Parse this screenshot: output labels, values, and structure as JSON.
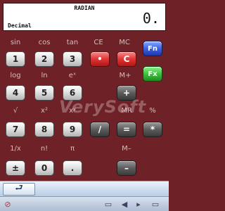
{
  "display": {
    "mode": "RADIAN",
    "value": "0.",
    "base": "Decimal"
  },
  "labels": {
    "sin": "sin",
    "cos": "cos",
    "tan": "tan",
    "ce": "CE",
    "mc": "MC",
    "log": "log",
    "ln": "ln",
    "exp": "eˣ",
    "mplus": "M+",
    "sqrt": "√",
    "square": "x²",
    "pow": "xʸ",
    "mr": "MR",
    "percent": "%",
    "recip": "1/x",
    "factorial": "n!",
    "pi": "π",
    "mminus": "M–"
  },
  "keys": {
    "k1": "1",
    "k2": "2",
    "k3": "3",
    "ce": "•",
    "mc": "C",
    "fn": "Fn",
    "fx": "Fx",
    "k4": "4",
    "k5": "5",
    "k6": "6",
    "plus": "+",
    "k7": "7",
    "k8": "8",
    "k9": "9",
    "divide": "/",
    "equals": "=",
    "multiply": "*",
    "sign": "±",
    "k0": "0",
    "dot": ".",
    "minus": "–"
  },
  "watermark": "VerySoft",
  "command_bar": {
    "back": "⮐"
  },
  "status_bar": {
    "left_icon": "⊘",
    "icons": [
      "▭",
      "◀",
      "▸",
      "▭"
    ]
  },
  "colors": {
    "background": "#6e2227",
    "accent_red": "#e03535",
    "accent_blue": "#3e62e0",
    "accent_green": "#3fc23f"
  }
}
